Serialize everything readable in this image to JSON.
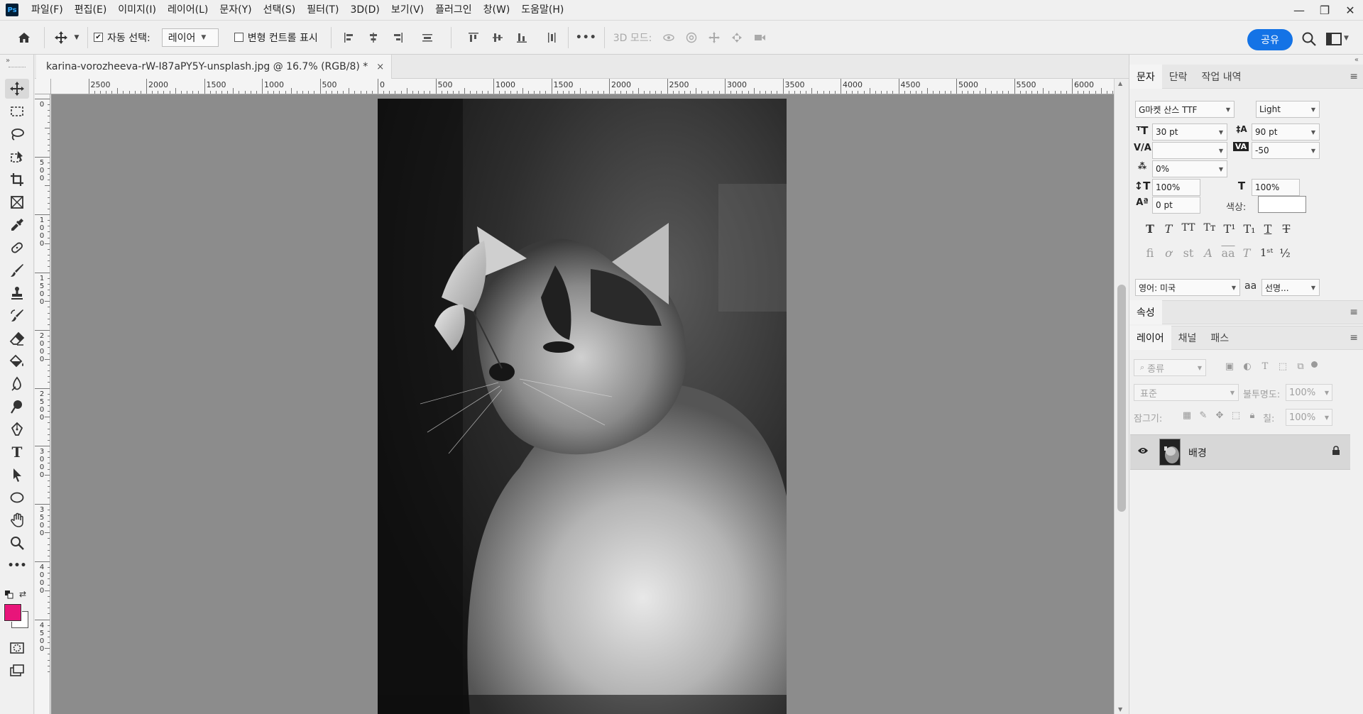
{
  "app": {
    "logo": "Ps"
  },
  "menu": [
    "파일(F)",
    "편집(E)",
    "이미지(I)",
    "레이어(L)",
    "문자(Y)",
    "선택(S)",
    "필터(T)",
    "3D(D)",
    "보기(V)",
    "플러그인",
    "창(W)",
    "도움말(H)"
  ],
  "window_controls": {
    "minimize": "—",
    "restore": "❐",
    "close": "✕"
  },
  "options_bar": {
    "auto_select_label": "자동 선택:",
    "auto_select_checked": true,
    "auto_select_value": "레이어",
    "transform_controls_label": "변형 컨트롤 표시",
    "transform_controls_checked": false,
    "more": "•••",
    "mode_3d_label": "3D 모드:",
    "share_label": "공유"
  },
  "document": {
    "tab_title": "karina-vorozheeva-rW-I87aPY5Y-unsplash.jpg @ 16.7% (RGB/8) *",
    "close": "×"
  },
  "ruler": {
    "h_labels": [
      "2500",
      "2000",
      "1500",
      "1000",
      "500",
      "0",
      "500",
      "1000",
      "1500",
      "2000",
      "2500",
      "3000",
      "3500",
      "4000",
      "4500",
      "5000",
      "5500",
      "6000"
    ],
    "v_labels": [
      "0",
      "500",
      "1000",
      "1500",
      "2000",
      "2500",
      "3000",
      "3500",
      "4000",
      "4500"
    ]
  },
  "right_panel": {
    "char_tabs": [
      "문자",
      "단락",
      "작업 내역"
    ],
    "font_family": "G마켓 산스 TTF",
    "font_style": "Light",
    "font_size": "30 pt",
    "leading": "90 pt",
    "kerning": "",
    "tracking": "-50",
    "tsume": "0%",
    "vertical_scale": "100%",
    "horizontal_scale": "100%",
    "baseline_shift": "0 pt",
    "color_label": "색상:",
    "language": "영어: 미국",
    "antialias_label": "aa",
    "antialias": "선명...",
    "properties_tab": "속성",
    "layer_tabs": [
      "레이어",
      "채널",
      "패스"
    ],
    "filter_placeholder": "종류",
    "blend_mode": "표준",
    "opacity_label": "불투명도:",
    "opacity": "100%",
    "lock_label": "잠그기:",
    "fill_label": "칠:",
    "fill": "100%",
    "layer_name": "배경"
  },
  "colors": {
    "foreground": "#e8157a",
    "background": "#ffffff",
    "accent": "#1473e6"
  }
}
